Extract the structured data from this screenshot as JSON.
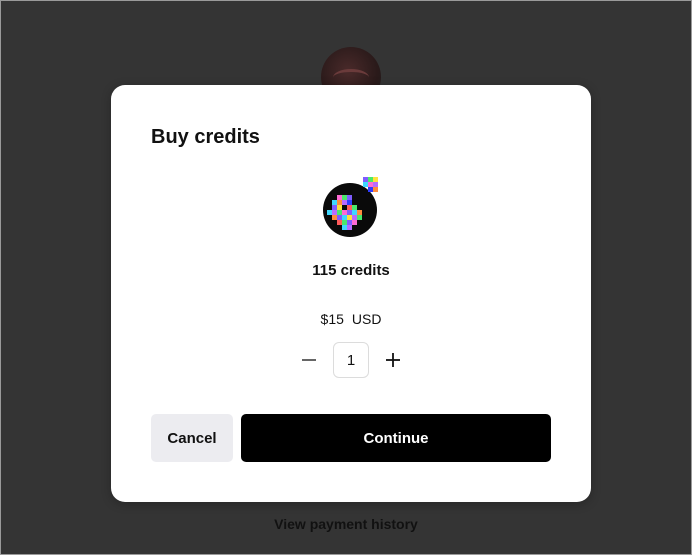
{
  "background": {
    "view_history_label": "View payment history"
  },
  "modal": {
    "title": "Buy credits",
    "product": {
      "credits_label": "115 credits",
      "price": "$15",
      "currency": "USD"
    },
    "quantity": {
      "value": "1",
      "decrement_symbol": "minus-icon",
      "increment_symbol": "plus-icon"
    },
    "cancel_label": "Cancel",
    "continue_label": "Continue"
  },
  "colors": {
    "overlay": "#343434",
    "primary_button": "#000000",
    "secondary_button": "#ececf0"
  }
}
